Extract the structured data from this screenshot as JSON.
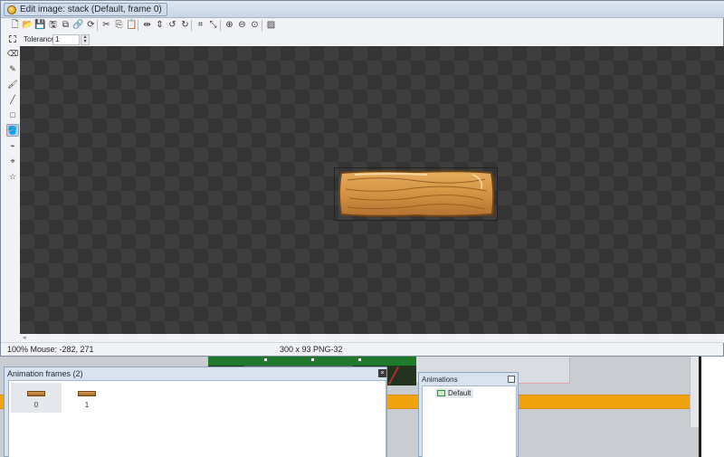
{
  "window": {
    "title": "Edit image: stack (Default, frame 0)"
  },
  "toolbar": {
    "buttons": [
      {
        "name": "new-icon",
        "glyph": "🗋"
      },
      {
        "name": "open-icon",
        "glyph": "📂"
      },
      {
        "name": "save-icon",
        "glyph": "💾"
      },
      {
        "name": "save-as-icon",
        "glyph": "🖫"
      },
      {
        "name": "external-edit-icon",
        "glyph": "⧉"
      },
      {
        "name": "link-icon",
        "glyph": "🔗"
      },
      {
        "name": "reload-icon",
        "glyph": "⟳"
      },
      {
        "name": "cut-icon",
        "glyph": "✂"
      },
      {
        "name": "copy-icon",
        "glyph": "⎘"
      },
      {
        "name": "paste-icon",
        "glyph": "📋"
      },
      {
        "name": "flip-horizontal-icon",
        "glyph": "⇹"
      },
      {
        "name": "flip-vertical-icon",
        "glyph": "⇕"
      },
      {
        "name": "rotate-left-icon",
        "glyph": "↺"
      },
      {
        "name": "rotate-right-icon",
        "glyph": "↻"
      },
      {
        "name": "crop-icon",
        "glyph": "⌗"
      },
      {
        "name": "resize-icon",
        "glyph": "⤡"
      },
      {
        "name": "zoom-in-icon",
        "glyph": "⊕"
      },
      {
        "name": "zoom-out-icon",
        "glyph": "⊖"
      },
      {
        "name": "zoom-actual-icon",
        "glyph": "⊙"
      },
      {
        "name": "image-settings-icon",
        "glyph": "▨"
      }
    ]
  },
  "options": {
    "tolerance_label": "Tolerance",
    "tolerance_value": "1"
  },
  "tools": [
    {
      "name": "eraser-tool-icon",
      "glyph": "⌫",
      "active": false
    },
    {
      "name": "pencil-tool-icon",
      "glyph": "✎",
      "active": false
    },
    {
      "name": "brush-tool-icon",
      "glyph": "🖌",
      "active": false
    },
    {
      "name": "line-tool-icon",
      "glyph": "╱",
      "active": false
    },
    {
      "name": "rectangle-tool-icon",
      "glyph": "□",
      "active": false
    },
    {
      "name": "fill-bucket-tool-icon",
      "glyph": "🪣",
      "active": true
    },
    {
      "name": "eyedropper-tool-icon",
      "glyph": "⌁",
      "active": false
    },
    {
      "name": "hotspot-tool-icon",
      "glyph": "⌖",
      "active": false
    },
    {
      "name": "polygon-tool-icon",
      "glyph": "☆",
      "active": false
    }
  ],
  "status": {
    "zoom_mouse": "100%  Mouse: -282, 271",
    "image_info": "300 x 93  PNG-32"
  },
  "frames_panel": {
    "title": "Animation frames (2)",
    "frames": [
      "0",
      "1"
    ]
  },
  "animations_panel": {
    "title": "Animations",
    "items": [
      "Default"
    ]
  },
  "colors": {
    "canvas_dark": "#353535",
    "canvas_light": "#3e3e3e",
    "wood": "#d89a4c",
    "orange_strip": "#f0a50f"
  }
}
